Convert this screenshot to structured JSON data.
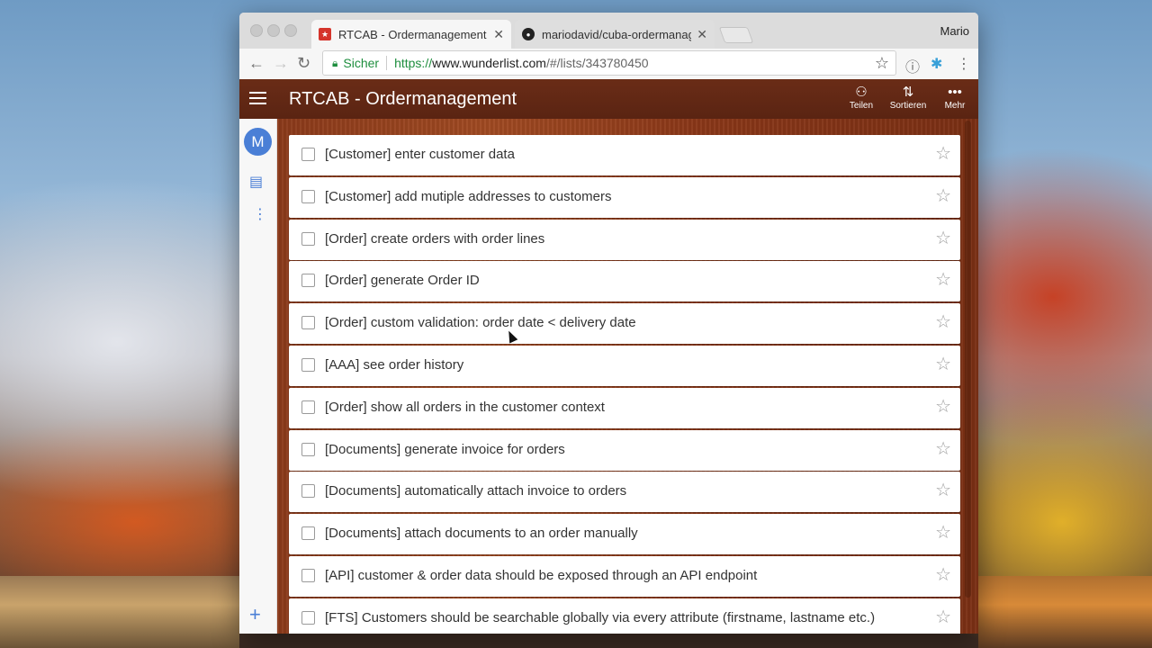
{
  "browser": {
    "tabs": [
      {
        "title": "RTCAB - Ordermanagement - W",
        "active": true,
        "favicon": "wunderlist-star-icon"
      },
      {
        "title": "mariodavid/cuba-ordermanagement",
        "active": false,
        "favicon": "github-icon"
      }
    ],
    "profile": "Mario",
    "omnibox": {
      "secure_label": "Sicher",
      "scheme": "https://",
      "host": "www.wunderlist.com",
      "path": "/#/lists/343780450"
    }
  },
  "app": {
    "list_title": "RTCAB - Ordermanagement",
    "actions": [
      {
        "label": "Teilen",
        "icon": "share-person-icon"
      },
      {
        "label": "Sortieren",
        "icon": "sort-az-icon"
      },
      {
        "label": "Mehr",
        "icon": "more-dots-icon"
      }
    ],
    "avatar_letter": "M",
    "accent_color": "#4a7fd6",
    "header_color": "#5e2714"
  },
  "tasks": [
    "[Customer] enter customer data",
    "[Customer] add mutiple addresses to customers",
    "[Order] create orders with order lines",
    "[Order] generate Order ID",
    "[Order] custom validation: order date < delivery date",
    "[AAA] see order history",
    "[Order] show all orders in the customer context",
    "[Documents] generate invoice for orders",
    "[Documents] automatically attach invoice to orders",
    "[Documents] attach documents to an order manually",
    "[API] customer & order data should be exposed through an API endpoint",
    "[FTS] Customers should be searchable globally via every attribute (firstname, lastname etc.)"
  ]
}
